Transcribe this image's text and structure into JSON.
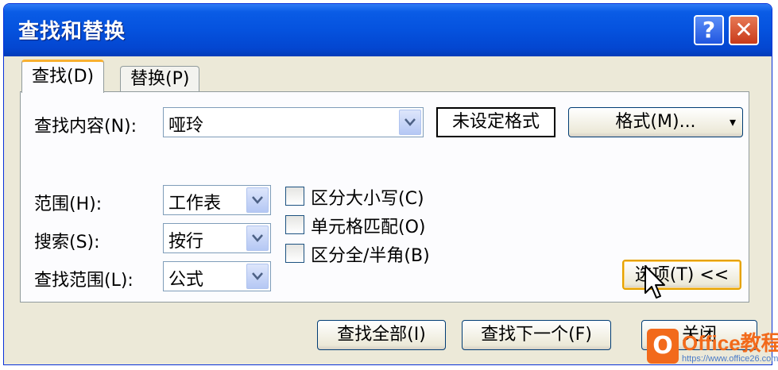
{
  "window": {
    "title": "查找和替换",
    "help_glyph": "?",
    "close_glyph": "✕"
  },
  "tabs": [
    {
      "label": "查找(D)",
      "active": true
    },
    {
      "label": "替换(P)",
      "active": false
    }
  ],
  "find": {
    "label": "查找内容(N):",
    "value": "哑玲",
    "format_status": "未设定格式",
    "format_button": "格式(M)...",
    "format_button_arrow": "▾"
  },
  "options": {
    "scope_label": "范围(H):",
    "scope_value": "工作表",
    "search_label": "搜索(S):",
    "search_value": "按行",
    "lookin_label": "查找范围(L):",
    "lookin_value": "公式"
  },
  "checkboxes": [
    {
      "label": "区分大小写(C)",
      "checked": false
    },
    {
      "label": "单元格匹配(O)",
      "checked": false
    },
    {
      "label": "区分全/半角(B)",
      "checked": false
    }
  ],
  "options_button": "选项(T) <<",
  "footer": {
    "find_all": "查找全部(I)",
    "find_next": "查找下一个(F)",
    "close": "关闭"
  },
  "watermark": {
    "logo_letter": "O",
    "brand": "Office教程网",
    "url": "https://www.office26.com"
  },
  "colors": {
    "titlebar": "#0552de",
    "close": "#c83a1a",
    "focus": "#e5a200",
    "brand": "#f26a1b"
  }
}
